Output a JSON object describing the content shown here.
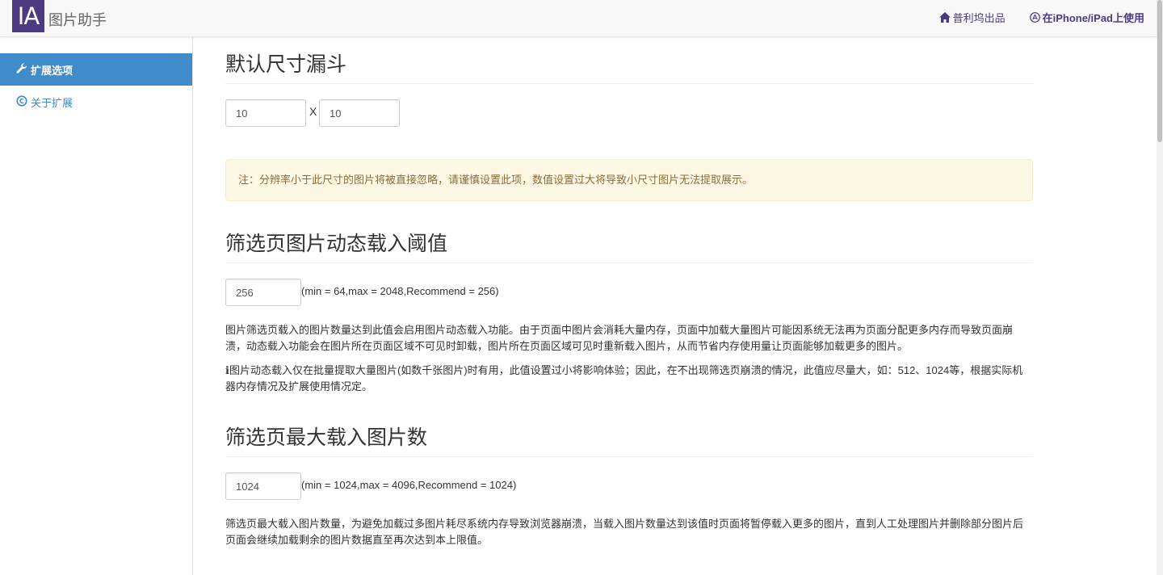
{
  "navbar": {
    "logo_text": "IA",
    "app_title": "图片助手",
    "links": {
      "home": {
        "label": "普利坞出品",
        "icon": "home-icon"
      },
      "ios": {
        "label": "在iPhone/iPad上使用",
        "icon": "app-store-icon"
      }
    }
  },
  "sidebar": {
    "items": [
      {
        "label": "扩展选项",
        "icon": "wrench-icon",
        "active": true
      },
      {
        "label": "关于扩展",
        "icon": "copyright-icon",
        "active": false
      }
    ]
  },
  "sections": {
    "size_filter": {
      "title": "默认尺寸漏斗",
      "width_value": "10",
      "height_value": "10",
      "separator": "X",
      "note": "注：分辨率小于此尺寸的图片将被直接忽略，请谨慎设置此项，数值设置过大将导致小尺寸图片无法提取展示。"
    },
    "dynamic_load": {
      "title": "筛选页图片动态载入阈值",
      "value": "256",
      "range_hint": "(min = 64,max = 2048,Recommend = 256)",
      "desc1": "图片筛选页载入的图片数量达到此值会启用图片动态载入功能。由于页面中图片会消耗大量内存，页面中加载大量图片可能因系统无法再为页面分配更多内存而导致页面崩溃，动态载入功能会在图片所在页面区域不可见时卸载，图片所在页面区域可见时重新载入图片，从而节省内存使用量让页面能够加载更多的图片。",
      "desc2_icon": "ℹ",
      "desc2": "图片动态载入仅在批量提取大量图片(如数千张图片)时有用，此值设置过小将影响体验；因此，在不出现筛选页崩溃的情况，此值应尽量大，如：512、1024等，根据实际机器内存情况及扩展使用情况定。"
    },
    "max_load": {
      "title": "筛选页最大载入图片数",
      "value": "1024",
      "range_hint": "(min = 1024,max = 4096,Recommend = 1024)",
      "desc": "筛选页最大载入图片数量，为避免加载过多图片耗尽系统内存导致浏览器崩溃，当载入图片数量达到该值时页面将暂停载入更多的图片，直到人工处理图片并删除部分图片后页面会继续加载剩余的图片数据直至再次达到本上限值。"
    }
  },
  "colors": {
    "brand": "#4b3a7f",
    "active_nav": "#428bca",
    "alert_bg": "#fcf8e3",
    "alert_text": "#8a6d3b"
  }
}
